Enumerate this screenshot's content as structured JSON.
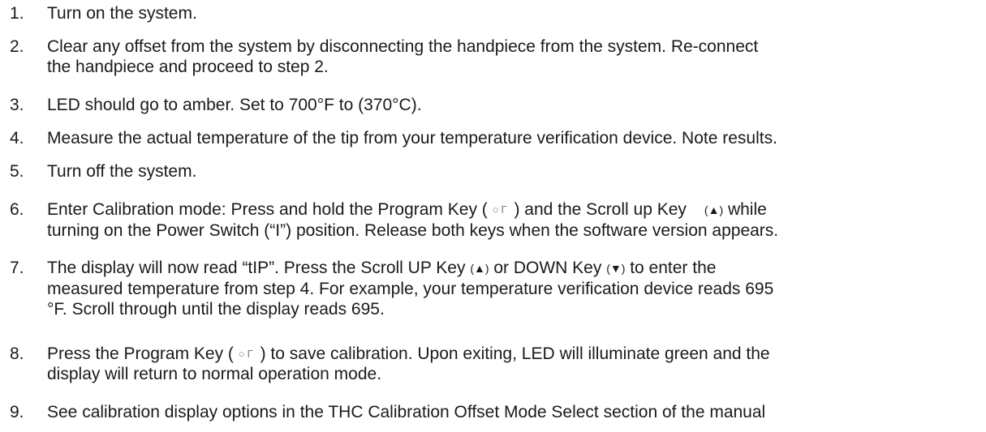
{
  "steps": [
    {
      "num": "1.",
      "text": "Turn on the system."
    },
    {
      "num": "2.",
      "line1": "Clear any offset from the system by disconnecting the handpiece from the system. Re-connect",
      "line2": "the handpiece and proceed to step 2."
    },
    {
      "num": "3.",
      "text": "LED should go to amber. Set to 700°F to (370°C)."
    },
    {
      "num": "4.",
      "text": "Measure the actual temperature of the tip from your temperature verification device.  Note results."
    },
    {
      "num": "5.",
      "text": "Turn off the system."
    },
    {
      "num": "6.",
      "l1_a": "Enter Calibration mode:  Press and hold the Program Key ( ",
      "l1_b": " ) and the Scroll up Key",
      "l1_c": " while",
      "line2": "turning on the Power Switch (“I”) position. Release both keys when the software version appears."
    },
    {
      "num": "7.",
      "l1_a": "The display will now read “tIP”. Press the Scroll UP Key ",
      "l1_b": " or DOWN Key ",
      "l1_c": " to enter the",
      "line2": "measured temperature from step 4.  For example, your temperature verification device reads 695",
      "line3": "°F. Scroll through until the display reads 695."
    },
    {
      "num": "8.",
      "l1_a": "Press the Program Key ( ",
      "l1_b": " ) to save calibration. Upon exiting, LED will illuminate green and the",
      "line2": "display will return to normal operation mode."
    },
    {
      "num": "9.",
      "text": "See calibration display options in the THC Calibration Offset Mode Select section of the manual"
    }
  ],
  "icons": {
    "program_key": "program-key-icon",
    "up_arrow": "(▲)",
    "down_arrow": "(▼)"
  }
}
